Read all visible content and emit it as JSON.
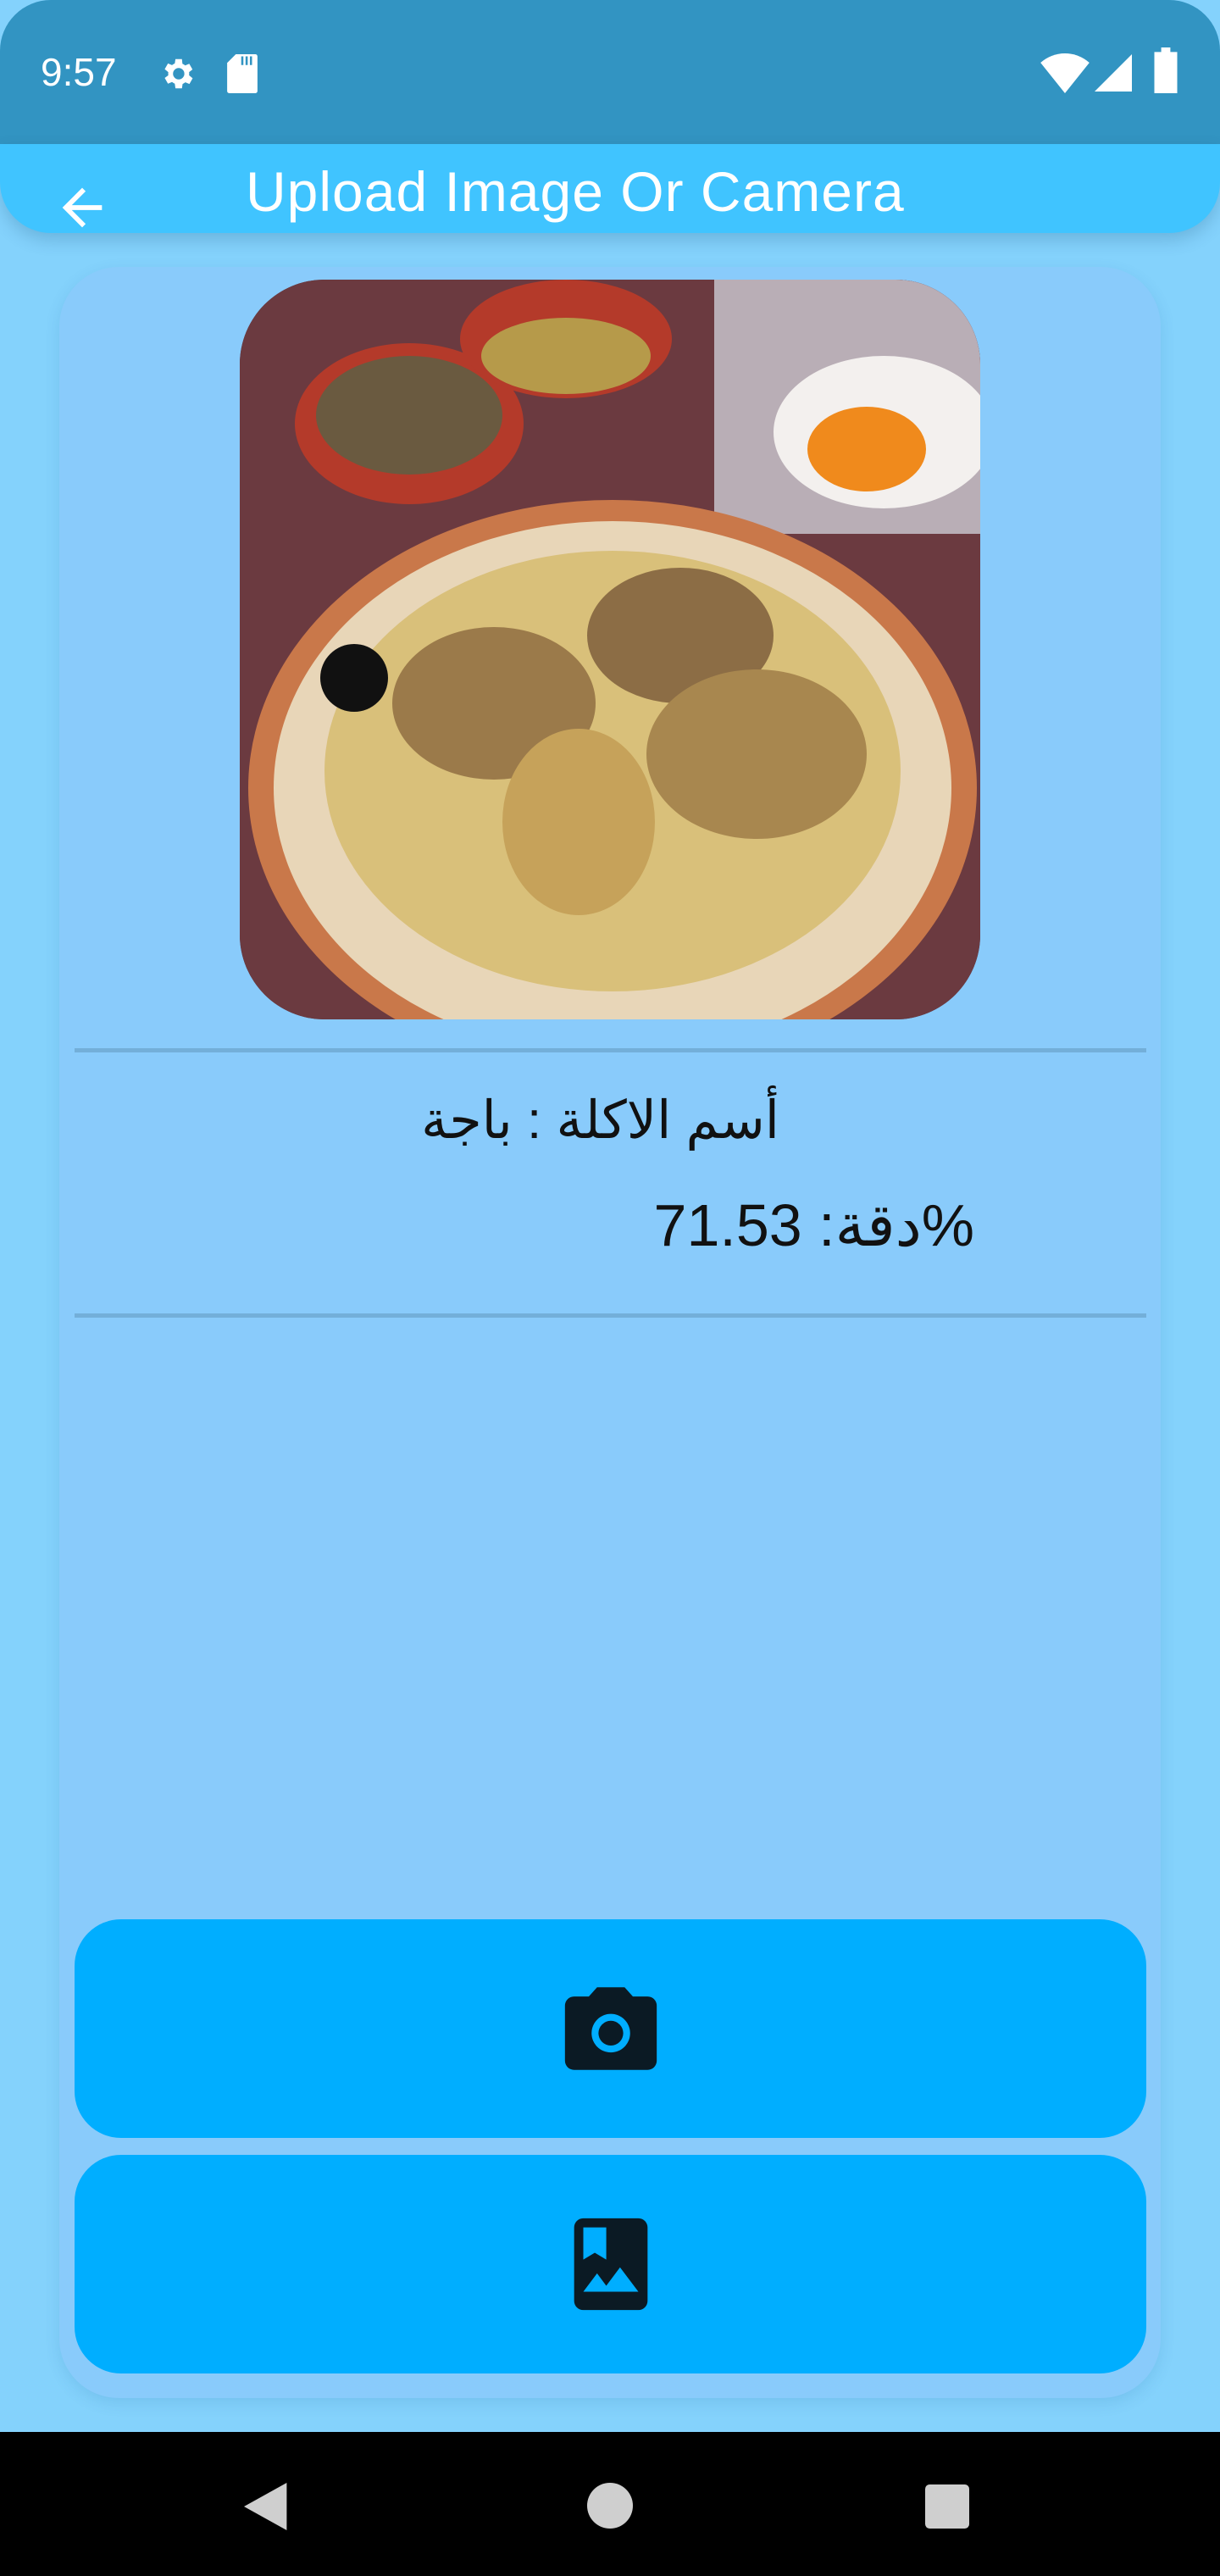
{
  "status_bar": {
    "time": "9:57",
    "icons": [
      "gear-icon",
      "sd-card-icon",
      "wifi-icon",
      "signal-icon",
      "battery-icon"
    ]
  },
  "app_bar": {
    "title": "Upload Image Or Camera",
    "back_icon": "arrow-left-icon"
  },
  "result": {
    "food_name_line": "أسم الاكلة  : باجة",
    "accuracy_line": "%دقة: 71.53"
  },
  "buttons": {
    "camera_icon": "camera-icon",
    "gallery_icon": "photo-album-icon"
  },
  "colors": {
    "status": "#3294c2",
    "appbar": "#40c4ff",
    "card": "#89cbfb",
    "button": "#00aeff",
    "background": "#84d2fc"
  }
}
